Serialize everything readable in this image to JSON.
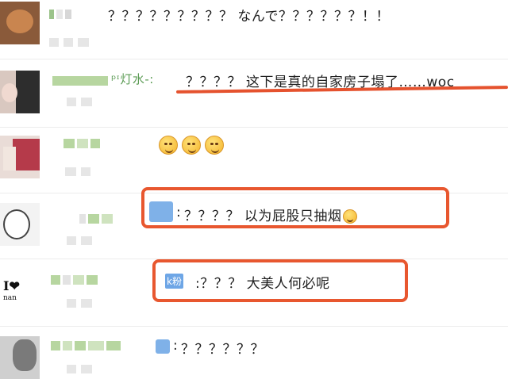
{
  "messages": [
    {
      "id": "m1",
      "prefix": "",
      "text": "？？？？？？？？？ なんで？？？？？？！！"
    },
    {
      "id": "m2",
      "prefix": "ᵖᶦ灯水-:",
      "text": "？？？？ 这下是真的自家房子塌了……woc"
    },
    {
      "id": "m3",
      "prefix": "",
      "text": ""
    },
    {
      "id": "m4",
      "prefix": ":",
      "text": "？？？？ 以为屁股只抽烟"
    },
    {
      "id": "m5",
      "prefix": "k粉",
      "text": ":？？？ 大美人何必呢"
    },
    {
      "id": "m6",
      "prefix": ":",
      "text": "？？？？？？"
    }
  ],
  "avatars": {
    "row5_logo": "I❤",
    "row5_sub": "nan"
  },
  "colors": {
    "annotation_red": "#e5522e",
    "blur_green": "#a9cf8e",
    "blur_gray": "#e4e4e4",
    "folder_blue": "#7fb1e8"
  },
  "icons": [
    "laughing-emoji-icon",
    "folder-icon"
  ]
}
